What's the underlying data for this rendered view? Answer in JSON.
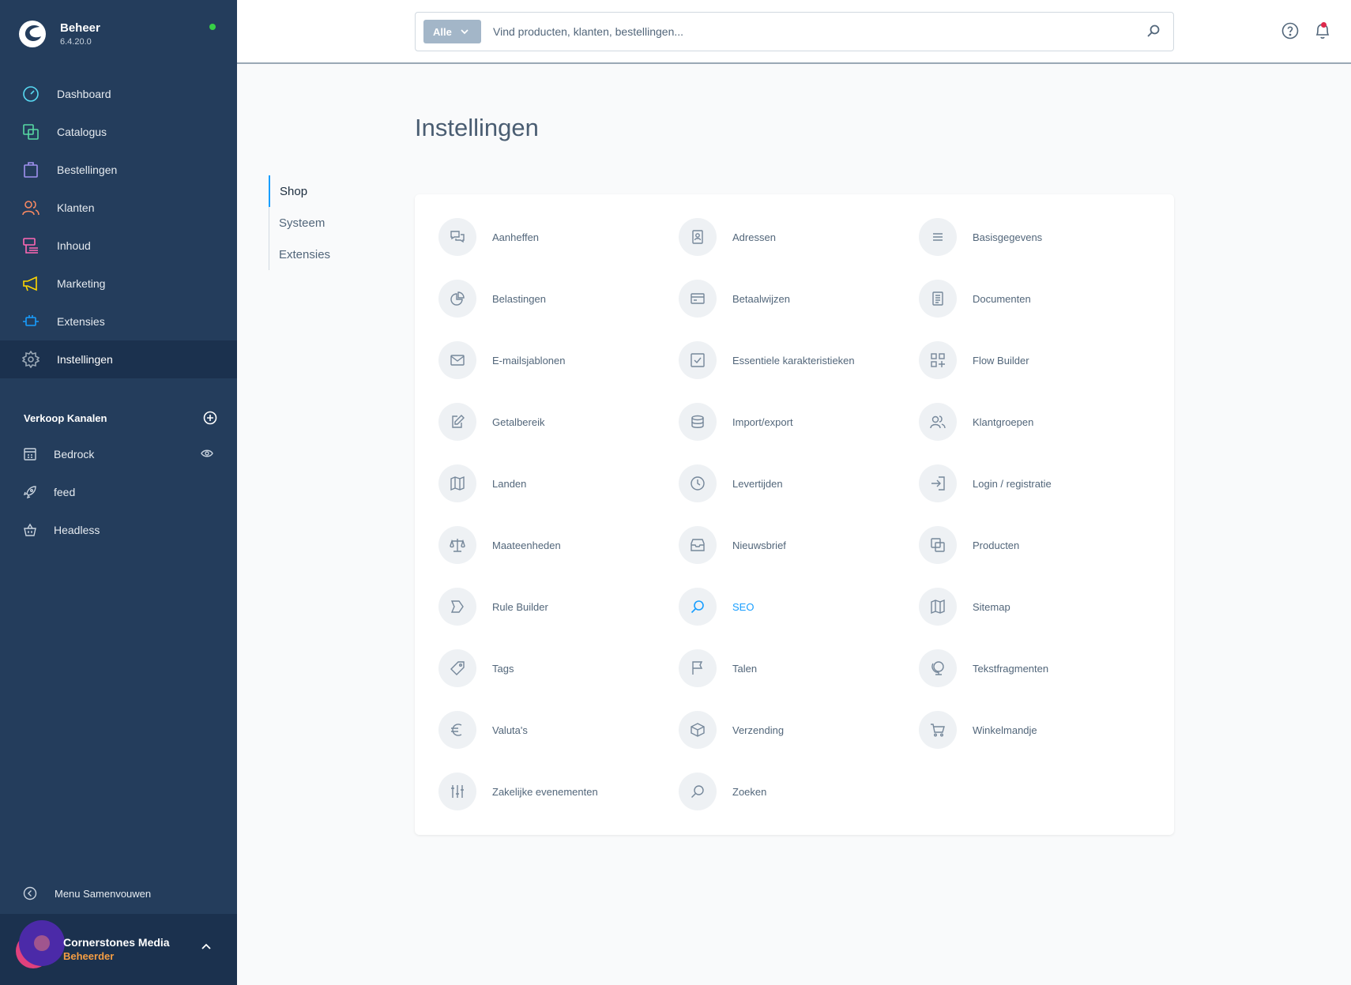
{
  "brand": {
    "name": "Beheer",
    "version": "6.4.20.0"
  },
  "nav": [
    {
      "label": "Dashboard",
      "icon": "dashboard-icon",
      "color": "#57d9f2"
    },
    {
      "label": "Catalogus",
      "icon": "catalog-icon",
      "color": "#57d9a3"
    },
    {
      "label": "Bestellingen",
      "icon": "orders-icon",
      "color": "#a092f0"
    },
    {
      "label": "Klanten",
      "icon": "customers-icon",
      "color": "#f88962"
    },
    {
      "label": "Inhoud",
      "icon": "content-icon",
      "color": "#ff68b4"
    },
    {
      "label": "Marketing",
      "icon": "marketing-icon",
      "color": "#ffd700"
    },
    {
      "label": "Extensies",
      "icon": "extensions-icon",
      "color": "#189eff"
    },
    {
      "label": "Instellingen",
      "icon": "settings-icon",
      "color": "#9aa8b5"
    }
  ],
  "sales_channels": {
    "title": "Verkoop Kanalen",
    "items": [
      {
        "label": "Bedrock",
        "icon": "storefront-icon"
      },
      {
        "label": "feed",
        "icon": "rocket-icon"
      },
      {
        "label": "Headless",
        "icon": "basket-icon"
      }
    ]
  },
  "collapse_label": "Menu Samenvouwen",
  "user": {
    "name": "Cornerstones Media",
    "role": "Beheerder"
  },
  "search": {
    "type_label": "Alle",
    "placeholder": "Vind producten, klanten, bestellingen..."
  },
  "page": {
    "title": "Instellingen"
  },
  "tabs": [
    {
      "label": "Shop",
      "active": true
    },
    {
      "label": "Systeem",
      "active": false
    },
    {
      "label": "Extensies",
      "active": false
    }
  ],
  "settings": [
    {
      "label": "Aanheffen",
      "icon": "chat-icon"
    },
    {
      "label": "Adressen",
      "icon": "address-book-icon"
    },
    {
      "label": "Basisgegevens",
      "icon": "list-icon"
    },
    {
      "label": "Belastingen",
      "icon": "pie-chart-icon"
    },
    {
      "label": "Betaalwijzen",
      "icon": "credit-card-icon"
    },
    {
      "label": "Documenten",
      "icon": "document-icon"
    },
    {
      "label": "E-mailsjablonen",
      "icon": "envelope-icon"
    },
    {
      "label": "Essentiele karakteristieken",
      "icon": "checkbox-icon"
    },
    {
      "label": "Flow Builder",
      "icon": "flow-icon"
    },
    {
      "label": "Getalbereik",
      "icon": "edit-icon"
    },
    {
      "label": "Import/export",
      "icon": "database-icon"
    },
    {
      "label": "Klantgroepen",
      "icon": "users-icon"
    },
    {
      "label": "Landen",
      "icon": "map-icon"
    },
    {
      "label": "Levertijden",
      "icon": "clock-icon"
    },
    {
      "label": "Login / registratie",
      "icon": "sign-in-icon"
    },
    {
      "label": "Maateenheden",
      "icon": "scale-icon"
    },
    {
      "label": "Nieuwsbrief",
      "icon": "inbox-icon"
    },
    {
      "label": "Producten",
      "icon": "products-icon"
    },
    {
      "label": "Rule Builder",
      "icon": "rule-icon"
    },
    {
      "label": "SEO",
      "icon": "search-icon",
      "highlight": true
    },
    {
      "label": "Sitemap",
      "icon": "map-icon"
    },
    {
      "label": "Tags",
      "icon": "tag-icon"
    },
    {
      "label": "Talen",
      "icon": "flag-icon"
    },
    {
      "label": "Tekstfragmenten",
      "icon": "globe-icon"
    },
    {
      "label": "Valuta's",
      "icon": "euro-icon"
    },
    {
      "label": "Verzending",
      "icon": "package-icon"
    },
    {
      "label": "Winkelmandje",
      "icon": "cart-icon"
    },
    {
      "label": "Zakelijke evenementen",
      "icon": "sliders-icon"
    },
    {
      "label": "Zoeken",
      "icon": "search-icon"
    }
  ]
}
